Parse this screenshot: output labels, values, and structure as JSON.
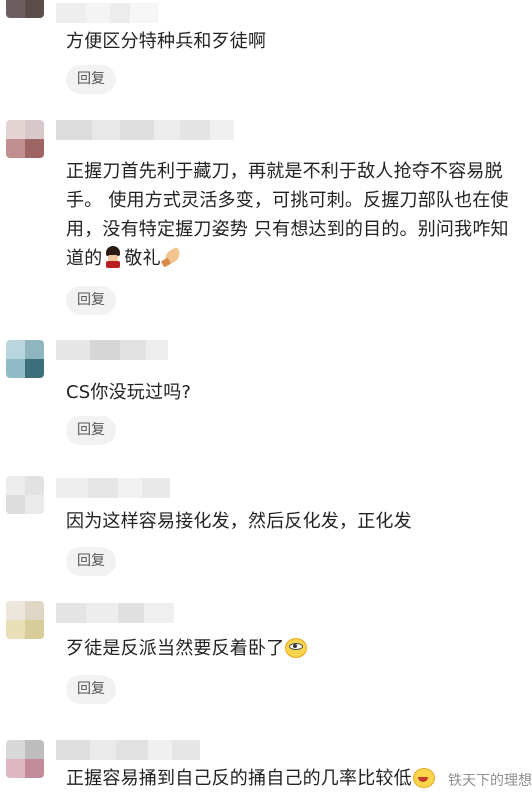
{
  "comments": [
    {
      "text": "方便区分特种兵和歹徒啊",
      "reply_label": "回复"
    },
    {
      "text": "正握刀首先利于藏刀，再就是不利于敌人抢夺不容易脱手。  使用方式灵活多变，可挑可刺。反握刀部队也在使用，没有特定握刀姿势  只有想达到的目的。别问我咋知道的",
      "text_tail": "敬礼",
      "reply_label": "回复"
    },
    {
      "text": "CS你没玩过吗?",
      "reply_label": "回复"
    },
    {
      "text": "因为这样容易接化发，然后反化发，正化发",
      "reply_label": "回复"
    },
    {
      "text": "歹徒是反派当然要反着卧了",
      "reply_label": "回复"
    },
    {
      "text": "正握容易捅到自己反的捅自己的几率比较低"
    }
  ],
  "emoji_icons": [
    "soldier-emoji-icon",
    "salute-emoji-icon",
    "smirk-emoji-icon",
    "laugh-emoji-icon"
  ],
  "watermark": "铁天下的理想",
  "colors": {
    "text": "#222222",
    "reply_bg": "#f2f2f2",
    "reply_text": "#555555",
    "watermark": "#8f8f8f"
  }
}
